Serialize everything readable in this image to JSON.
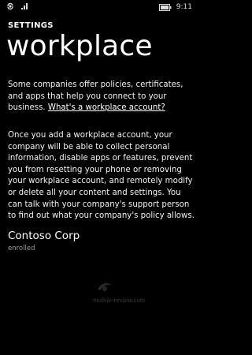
{
  "status_bar": {
    "time": "9:11",
    "icons": [
      "sync-icon",
      "signal-icon",
      "battery-icon"
    ]
  },
  "header": {
    "app_title": "SETTINGS",
    "page_title": "workplace"
  },
  "content": {
    "intro_text": "Some companies offer policies, certificates, and apps that help you connect to your business. ",
    "intro_link": "What's a workplace account?",
    "details_text": "Once you add a workplace account, your company will be able to collect personal information, disable apps or features, prevent you from resetting your phone or removing your workplace account, and remotely modify or delete all your content and settings. You can talk with your company's support person to find out what your company's policy allows."
  },
  "account": {
    "name": "Contoso Corp",
    "status": "enrolled"
  },
  "watermark": "mobile-review.com",
  "colors": {
    "background": "#000000",
    "text": "#ffffff",
    "subtle": "#9a9a9a"
  }
}
